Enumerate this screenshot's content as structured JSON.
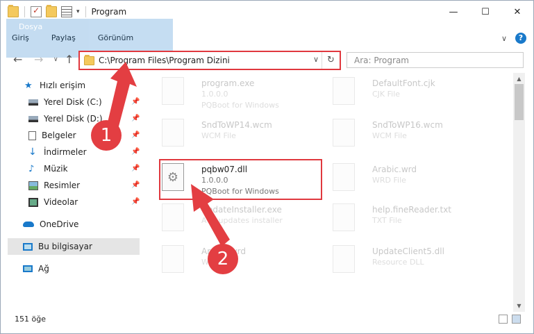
{
  "window": {
    "title": "Program",
    "controls": {
      "minimize": "—",
      "maximize": "☐",
      "close": "✕"
    }
  },
  "ribbon": {
    "tabs": [
      "Dosya",
      "Giriş",
      "Paylaş",
      "Görünüm"
    ],
    "expand_icon": "chevron-down-icon",
    "help_label": "?"
  },
  "address": {
    "path": "C:\\Program Files\\Program Dizini",
    "refresh": "↻",
    "dropdown": "∨"
  },
  "search": {
    "placeholder": "Ara: Program"
  },
  "nav_buttons": {
    "back": "←",
    "forward": "→",
    "up": "↑"
  },
  "sidebar": {
    "quick_access": "Hızlı erişim",
    "items": [
      {
        "label": "Yerel Disk (C:)",
        "icon": "drive-icon",
        "pinned": true
      },
      {
        "label": "Yerel Disk (D:)",
        "icon": "drive-icon",
        "pinned": true
      },
      {
        "label": "Belgeler",
        "icon": "documents-icon",
        "pinned": true
      },
      {
        "label": "İndirmeler",
        "icon": "download-icon",
        "pinned": true
      },
      {
        "label": "Müzik",
        "icon": "music-icon",
        "pinned": true
      },
      {
        "label": "Resimler",
        "icon": "pictures-icon",
        "pinned": true
      },
      {
        "label": "Videolar",
        "icon": "video-icon",
        "pinned": true
      }
    ],
    "onedrive": "OneDrive",
    "this_pc": "Bu bilgisayar",
    "network": "Ağ"
  },
  "files": [
    {
      "name": "program.exe",
      "line2": "1.0.0.0",
      "line3": "PQBoot for Windows",
      "col": 0,
      "row": 0
    },
    {
      "name": "DefaultFont.cjk",
      "line2": "CJK File",
      "line3": "",
      "col": 1,
      "row": 0
    },
    {
      "name": "SndToWP14.wcm",
      "line2": "WCM File",
      "line3": "",
      "col": 0,
      "row": 1
    },
    {
      "name": "SndToWP16.wcm",
      "line2": "WCM File",
      "line3": "",
      "col": 1,
      "row": 1
    },
    {
      "name": "pqbw07.dll",
      "line2": "1.0.0.0",
      "line3": "PQBoot for Windows",
      "col": 0,
      "row": 2,
      "highlighted": true
    },
    {
      "name": "Arabic.wrd",
      "line2": "WRD File",
      "line3": "",
      "col": 1,
      "row": 2
    },
    {
      "name": "UpdateInstaller.exe",
      "line2": "AVY updates installer",
      "line3": "",
      "col": 0,
      "row": 3
    },
    {
      "name": "help.fineReader.txt",
      "line2": "TXT File",
      "line3": "",
      "col": 1,
      "row": 3
    },
    {
      "name": "Arabic.wrd",
      "line2": "WRD File",
      "line3": "",
      "col": 0,
      "row": 4
    },
    {
      "name": "UpdateClient5.dll",
      "line2": "Resource DLL",
      "line3": "",
      "col": 1,
      "row": 4
    }
  ],
  "status": {
    "count": "151 öğe"
  },
  "annotations": {
    "step1": "1",
    "step2": "2",
    "color": "#e33e42"
  }
}
